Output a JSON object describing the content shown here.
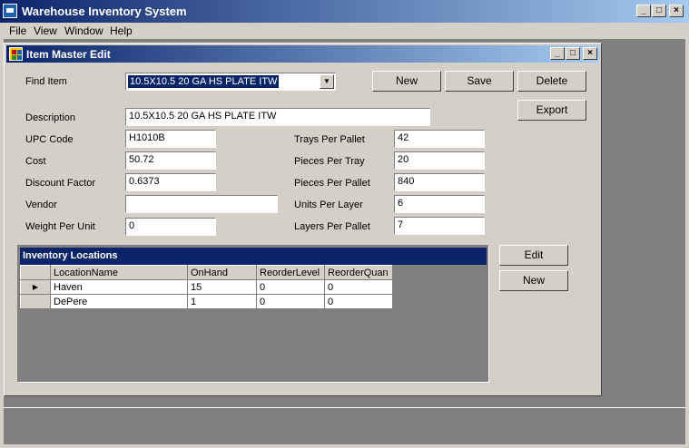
{
  "app": {
    "title": "Warehouse Inventory System",
    "menu": [
      "File",
      "View",
      "Window",
      "Help"
    ],
    "caption_buttons": {
      "minimize": "_",
      "maximize": "□",
      "close": "×"
    }
  },
  "child": {
    "title": "Item Master Edit",
    "find_item_label": "Find Item",
    "find_item_value": "10.5X10.5  20 GA HS PLATE ITW",
    "buttons": {
      "new": "New",
      "save": "Save",
      "delete": "Delete",
      "export": "Export",
      "grid_edit": "Edit",
      "grid_new": "New"
    },
    "fields": {
      "description": {
        "label": "Description",
        "value": "10.5X10.5  20 GA HS PLATE ITW"
      },
      "upc": {
        "label": "UPC Code",
        "value": "H1010B"
      },
      "cost": {
        "label": "Cost",
        "value": "50.72"
      },
      "discount": {
        "label": "Discount Factor",
        "value": "0.6373"
      },
      "vendor": {
        "label": "Vendor",
        "value": ""
      },
      "weight": {
        "label": "Weight Per Unit",
        "value": "0"
      },
      "trays_per_pallet": {
        "label": "Trays Per Pallet",
        "value": "42"
      },
      "pieces_per_tray": {
        "label": "Pieces Per Tray",
        "value": "20"
      },
      "pieces_per_pallet": {
        "label": "Pieces Per Pallet",
        "value": "840"
      },
      "units_per_layer": {
        "label": "Units Per Layer",
        "value": "6"
      },
      "layers_per_pallet": {
        "label": "Layers Per Pallet",
        "value": "7"
      }
    },
    "grid": {
      "caption": "Inventory Locations",
      "columns": [
        "LocationName",
        "OnHand",
        "ReorderLevel",
        "ReorderQuan"
      ],
      "current_row_marker": "▶",
      "rows": [
        [
          "Haven",
          "15",
          "0",
          "0"
        ],
        [
          "DePere",
          "1",
          "0",
          "0"
        ]
      ]
    }
  }
}
